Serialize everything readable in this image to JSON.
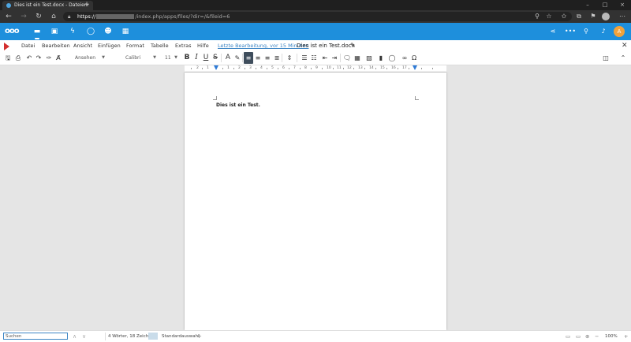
{
  "browser": {
    "tab_title": "Dies ist ein Test.docx - Dateien",
    "tab_close": "×",
    "new_tab": "+",
    "window_controls": [
      "–",
      "□",
      "×"
    ],
    "url_prefix": "https://",
    "url_rest": "/index.php/apps/files/?dir=/&fileid=6"
  },
  "nextcloud": {
    "logo": "ooo",
    "user_initial": "A"
  },
  "office": {
    "menus": [
      "Datei",
      "Bearbeiten",
      "Ansicht",
      "Einfügen",
      "Format",
      "Tabelle",
      "Extras",
      "Hilfe"
    ],
    "last_edit": "Letzte Bearbeitung, vor 15 Minuten",
    "document_name": "Dies ist ein Test.docx",
    "toolbar": {
      "style": "Ansehen",
      "font": "Calibri",
      "size": "11"
    },
    "ruler_numbers": [
      "2",
      "1",
      "1",
      "2",
      "3",
      "4",
      "5",
      "6",
      "7",
      "8",
      "9",
      "10",
      "11",
      "12",
      "13",
      "14",
      "15",
      "16",
      "17"
    ],
    "document_text": "Dies ist ein Test.",
    "status": {
      "search_placeholder": "Suchen",
      "word_count": "4 Wörter, 18 Zeichen",
      "page_style": "Standardauswahl",
      "zoom": "100%"
    }
  }
}
